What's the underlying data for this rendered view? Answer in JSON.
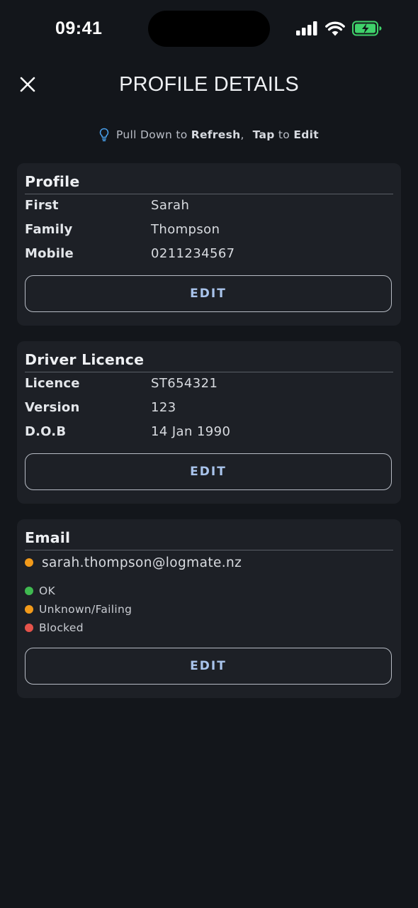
{
  "status_bar": {
    "time": "09:41",
    "icons": [
      "signal-icon",
      "wifi-icon",
      "battery-charging-icon"
    ]
  },
  "header": {
    "title": "PROFILE DETAILS",
    "close_icon": "close-icon"
  },
  "hint": {
    "icon": "lightbulb-icon",
    "part1": "Pull Down to ",
    "bold1": "Refresh",
    "sep": ",",
    "bold2": "Tap",
    "part2": " to ",
    "bold3": "Edit"
  },
  "profile": {
    "title": "Profile",
    "rows": [
      {
        "label": "First",
        "value": "Sarah"
      },
      {
        "label": "Family",
        "value": "Thompson"
      },
      {
        "label": "Mobile",
        "value": "0211234567"
      }
    ],
    "edit_label": "EDIT"
  },
  "licence": {
    "title": "Driver Licence",
    "rows": [
      {
        "label": "Licence",
        "value": "ST654321"
      },
      {
        "label": "Version",
        "value": "123"
      },
      {
        "label": "D.O.B",
        "value": "14 Jan 1990"
      }
    ],
    "edit_label": "EDIT"
  },
  "email": {
    "title": "Email",
    "address": "sarah.thompson@logmate.nz",
    "status_color": "#f29a1a",
    "legend": [
      {
        "label": "OK",
        "color": "#3fb950"
      },
      {
        "label": "Unknown/Failing",
        "color": "#f29a1a"
      },
      {
        "label": "Blocked",
        "color": "#e5534b"
      }
    ],
    "edit_label": "EDIT"
  },
  "colors": {
    "background": "#13161b",
    "card": "#1d2026",
    "accent": "#a9c4ec",
    "hint_icon": "#4aa3f0",
    "battery": "#3fd16a"
  }
}
